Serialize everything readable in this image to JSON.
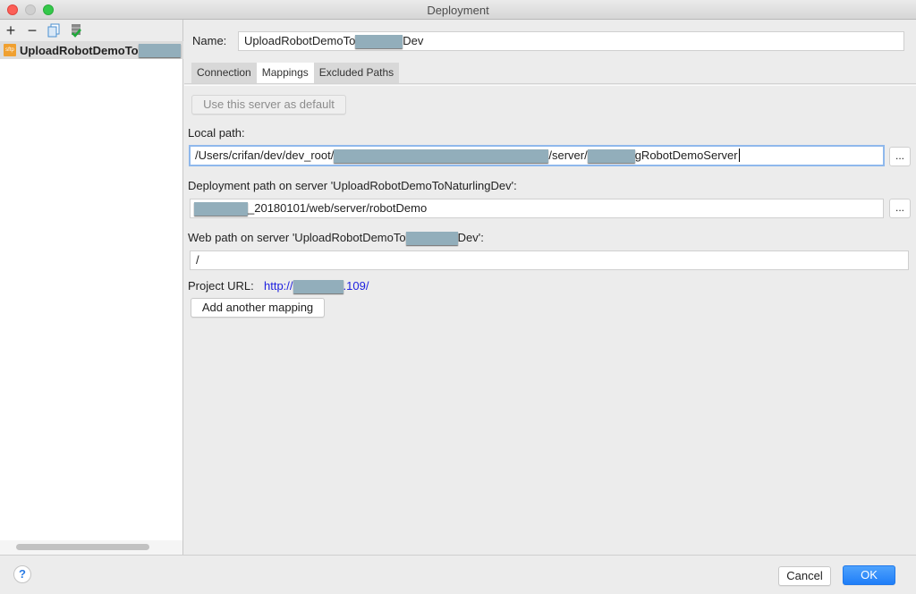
{
  "window": {
    "title": "Deployment"
  },
  "left_panel": {
    "toolbar": {
      "add": "+",
      "remove": "−"
    },
    "server_item": {
      "label": "UploadRobotDemoTo",
      "icon_text": "sftp"
    }
  },
  "form": {
    "name_label": "Name:",
    "name_value_prefix": "UploadRobotDemoTo",
    "name_value_suffix": "Dev",
    "tabs": [
      {
        "label": "Connection"
      },
      {
        "label": "Mappings"
      },
      {
        "label": "Excluded Paths"
      }
    ],
    "default_button": "Use this server as default",
    "local_path_label": "Local path:",
    "local_path_prefix": "/Users/crifan/dev/dev_root/",
    "local_path_mid": "/server/",
    "local_path_suffix": "gRobotDemoServer",
    "browse": "...",
    "deploy_path_label": "Deployment path on server 'UploadRobotDemoToNaturlingDev':",
    "deploy_path_value": "_20180101/web/server/robotDemo",
    "web_path_label_prefix": "Web path on server 'UploadRobotDemoTo",
    "web_path_label_suffix": "Dev':",
    "web_path_value": "/",
    "project_url_label": "Project URL:",
    "project_url_prefix": "http://",
    "project_url_suffix": ".109/",
    "add_mapping_button": "Add another mapping"
  },
  "footer": {
    "help": "?",
    "cancel": "Cancel",
    "ok": "OK"
  }
}
